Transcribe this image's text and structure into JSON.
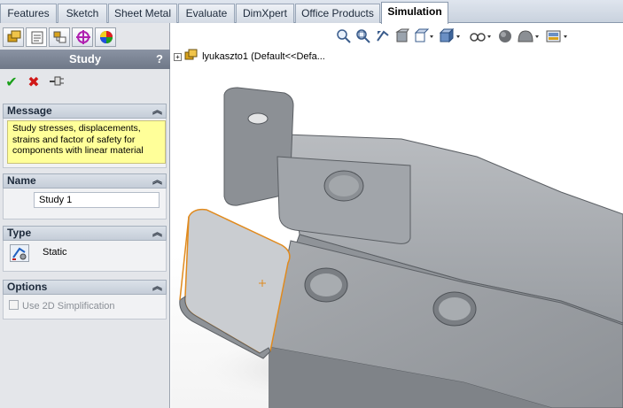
{
  "ribbon": {
    "tabs": [
      {
        "label": "Features"
      },
      {
        "label": "Sketch"
      },
      {
        "label": "Sheet Metal"
      },
      {
        "label": "Evaluate"
      },
      {
        "label": "DimXpert"
      },
      {
        "label": "Office Products"
      },
      {
        "label": "Simulation",
        "active": true
      }
    ]
  },
  "panel": {
    "pm_tabs": [
      "feature-manager-icon",
      "property-manager-icon",
      "configuration-manager-icon",
      "dimxpert-manager-icon",
      "display-manager-icon"
    ],
    "title": "Study",
    "help": "?",
    "actions": {
      "ok": "✔",
      "cancel": "✖",
      "pin": "pushpin-icon"
    },
    "message": {
      "header": "Message",
      "text": "Study stresses, displacements, strains and factor of safety  for components with linear material"
    },
    "name": {
      "header": "Name",
      "value": "Study 1"
    },
    "type": {
      "header": "Type",
      "value": "Static"
    },
    "options": {
      "header": "Options",
      "checkbox_label": "Use 2D Simplification",
      "checked": false
    },
    "collapse_glyph": "︽"
  },
  "graphics": {
    "tree_expand": "+",
    "tree_item": "lyukaszto1  (Default<<Defa...",
    "heads_up_icons": [
      "zoom-to-fit-icon",
      "zoom-to-area-icon",
      "previous-view-icon",
      "section-view-icon",
      "view-orientation-icon",
      "display-style-icon",
      "hide-show-items-icon",
      "edit-appearance-icon",
      "apply-scene-icon",
      "view-settings-icon"
    ]
  },
  "colors": {
    "accent_orange": "#e08a1e",
    "part_gray": "#9a9ea3",
    "title_bar": "#7a8393"
  }
}
